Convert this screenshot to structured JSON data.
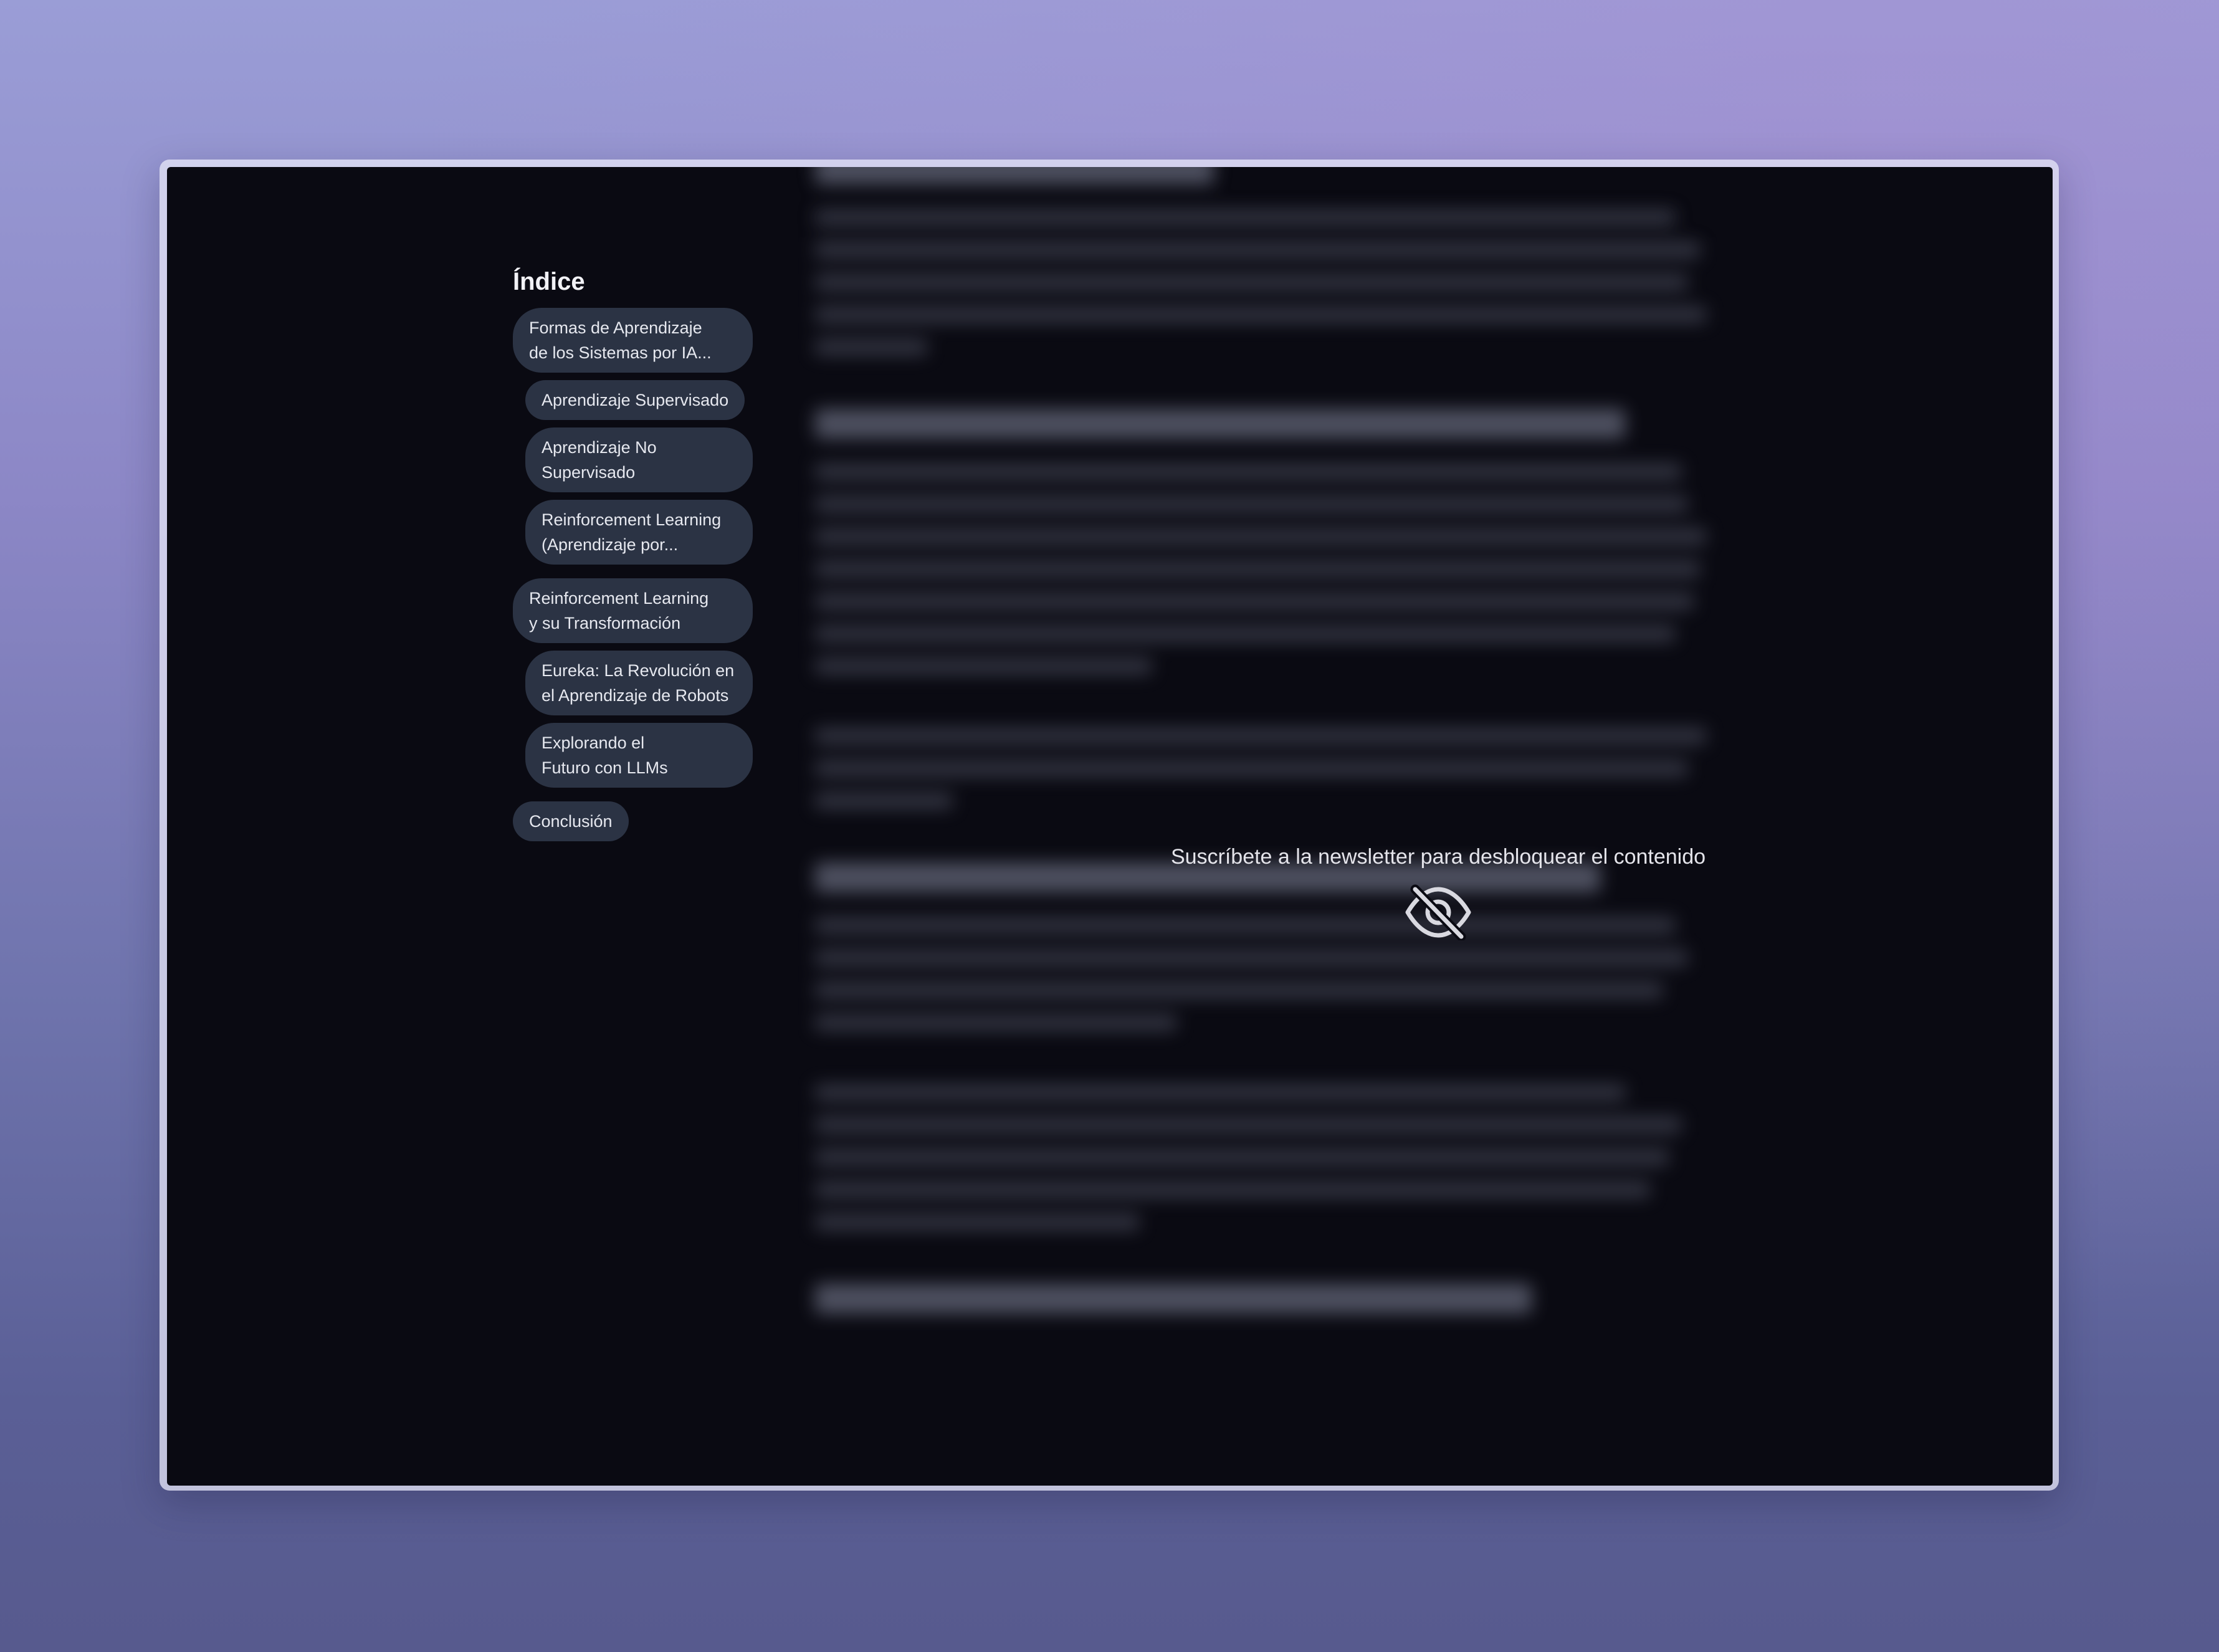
{
  "toc": {
    "title": "Índice",
    "items": [
      {
        "line1": "Formas de Aprendizaje",
        "line2": "de los Sistemas por IA...",
        "level": 1
      },
      {
        "line1": "Aprendizaje Supervisado",
        "line2": "",
        "level": 2
      },
      {
        "line1": "Aprendizaje No",
        "line2": "Supervisado",
        "level": 2
      },
      {
        "line1": "Reinforcement Learning",
        "line2": "(Aprendizaje por...",
        "level": 2
      },
      {
        "line1": "Reinforcement Learning",
        "line2": "y su Transformación",
        "level": 1
      },
      {
        "line1": "Eureka: La Revolución en",
        "line2": "el Aprendizaje de Robots",
        "level": 2
      },
      {
        "line1": "Explorando el",
        "line2": "Futuro con LLMs",
        "level": 2
      },
      {
        "line1": "Conclusión",
        "line2": "",
        "level": 1
      }
    ]
  },
  "paywall": {
    "message": "Suscríbete a la newsletter para desbloquear el contenido",
    "icon": "eye-slash-icon"
  },
  "colors": {
    "window_bg": "#0a0a12",
    "pill_bg": "#2b3344",
    "page_bg_top": "#9a9dd6",
    "page_bg_bottom": "#575a8e"
  }
}
